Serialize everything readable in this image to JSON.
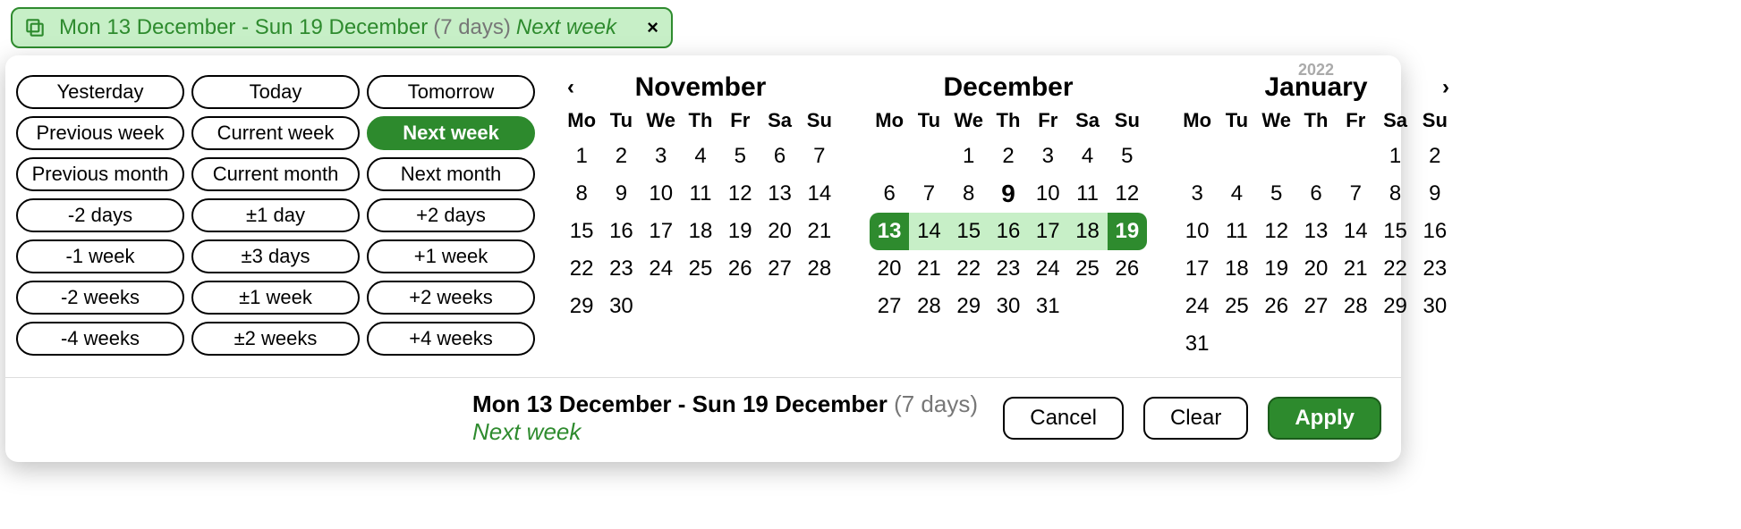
{
  "colors": {
    "accent": "#2e8b2e",
    "accent_light": "#c7efc7",
    "text_muted": "#777777"
  },
  "input": {
    "range": "Mon 13 December - Sun 19 December",
    "days": "(7 days)",
    "label": "Next week",
    "close": "×"
  },
  "presets": [
    {
      "label": "Yesterday",
      "active": false
    },
    {
      "label": "Today",
      "active": false
    },
    {
      "label": "Tomorrow",
      "active": false
    },
    {
      "label": "Previous week",
      "active": false
    },
    {
      "label": "Current week",
      "active": false
    },
    {
      "label": "Next week",
      "active": true
    },
    {
      "label": "Previous month",
      "active": false
    },
    {
      "label": "Current month",
      "active": false
    },
    {
      "label": "Next month",
      "active": false
    },
    {
      "label": "-2 days",
      "active": false
    },
    {
      "label": "±1 day",
      "active": false
    },
    {
      "label": "+2 days",
      "active": false
    },
    {
      "label": "-1 week",
      "active": false
    },
    {
      "label": "±3 days",
      "active": false
    },
    {
      "label": "+1 week",
      "active": false
    },
    {
      "label": "-2 weeks",
      "active": false
    },
    {
      "label": "±1 week",
      "active": false
    },
    {
      "label": "+2 weeks",
      "active": false
    },
    {
      "label": "-4 weeks",
      "active": false
    },
    {
      "label": "±2 weeks",
      "active": false
    },
    {
      "label": "+4 weeks",
      "active": false
    }
  ],
  "nav": {
    "prev": "‹",
    "next": "›"
  },
  "dow": [
    "Mo",
    "Tu",
    "We",
    "Th",
    "Fr",
    "Sa",
    "Su"
  ],
  "months": [
    {
      "title": "November",
      "year_tag": "",
      "show_prev": true,
      "show_next": false,
      "days_in_month": 30,
      "first_dow": 1,
      "today": null,
      "range_start": null,
      "range_end": null
    },
    {
      "title": "December",
      "year_tag": "",
      "show_prev": false,
      "show_next": false,
      "days_in_month": 31,
      "first_dow": 3,
      "today": 9,
      "range_start": 13,
      "range_end": 19
    },
    {
      "title": "January",
      "year_tag": "2022",
      "show_prev": false,
      "show_next": true,
      "days_in_month": 31,
      "first_dow": 6,
      "today": null,
      "range_start": null,
      "range_end": null
    }
  ],
  "footer": {
    "range": "Mon 13 December - Sun 19 December",
    "days": "(7 days)",
    "label": "Next week",
    "cancel": "Cancel",
    "clear": "Clear",
    "apply": "Apply"
  }
}
